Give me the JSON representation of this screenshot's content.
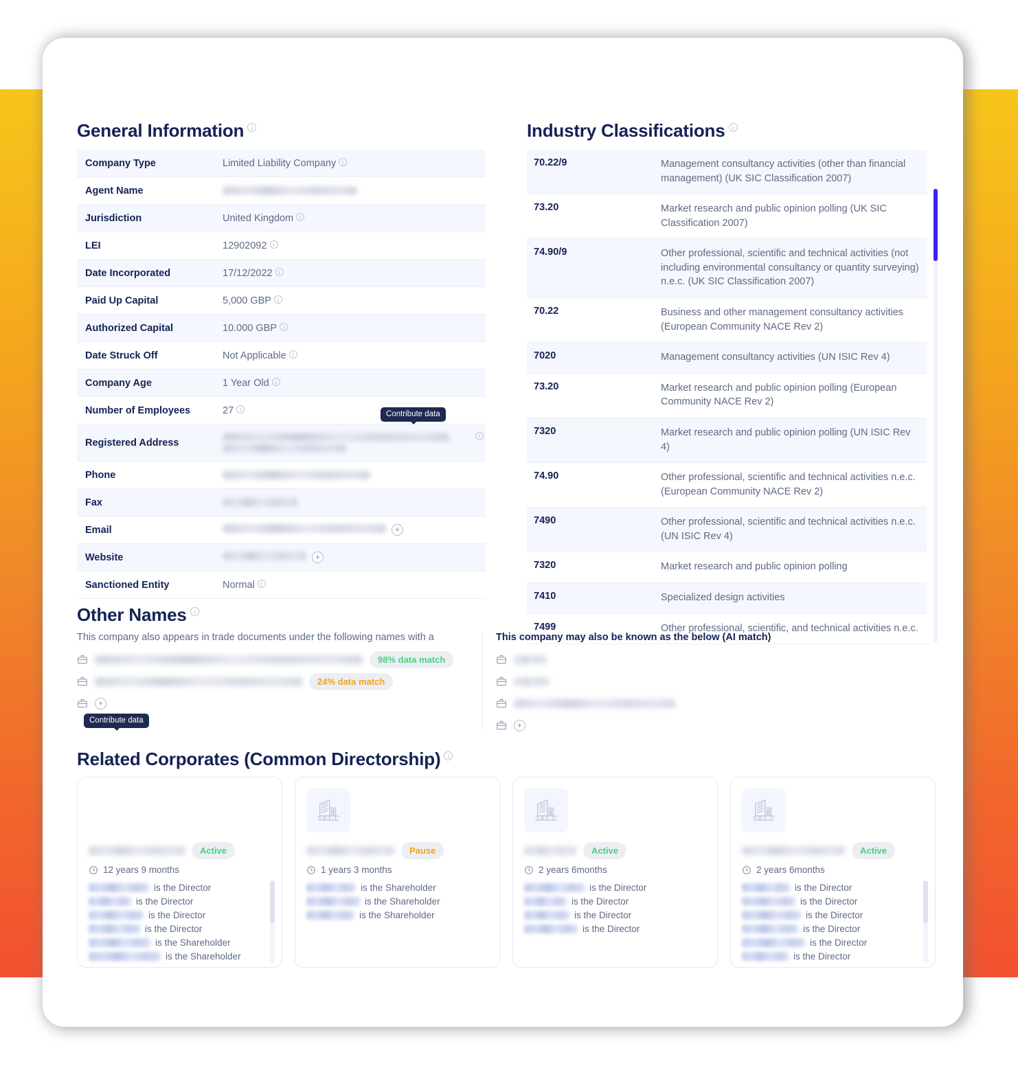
{
  "general_information": {
    "title": "General Information",
    "rows": [
      {
        "label": "Company Type",
        "value": "Limited Liability Company",
        "redacted": false,
        "info": true
      },
      {
        "label": "Agent Name",
        "value": "",
        "redacted": true,
        "blur_width": 196,
        "info": true
      },
      {
        "label": "Jurisdiction",
        "value": "United Kingdom",
        "redacted": false,
        "info": true
      },
      {
        "label": "LEI",
        "value": "12902092",
        "redacted": false,
        "info": true
      },
      {
        "label": "Date Incorporated",
        "value": "17/12/2022",
        "redacted": false,
        "info": true
      },
      {
        "label": "Paid Up Capital",
        "value": "5,000 GBP",
        "redacted": false,
        "info": true
      },
      {
        "label": "Authorized Capital",
        "value": "10.000 GBP",
        "redacted": false,
        "info": true
      },
      {
        "label": "Date Struck Off",
        "value": "Not Applicable",
        "redacted": false,
        "info": true
      },
      {
        "label": "Company Age",
        "value": "1 Year Old",
        "redacted": false,
        "info": true
      },
      {
        "label": "Number of Employees",
        "value": "27",
        "redacted": false,
        "info": true
      },
      {
        "label": "Registered Address",
        "value": "",
        "redacted": true,
        "two_line": true,
        "blur_width": 330,
        "blur_width2": 180,
        "info": true
      },
      {
        "label": "Phone",
        "value": "",
        "redacted": true,
        "blur_width": 215,
        "info": false
      },
      {
        "label": "Fax",
        "value": "",
        "redacted": true,
        "blur_width": 110,
        "info": false
      },
      {
        "label": "Email",
        "value": "",
        "redacted": true,
        "blur_width": 238,
        "plus": true,
        "tooltip": "Contribute data",
        "info": false
      },
      {
        "label": "Website",
        "value": "",
        "redacted": true,
        "blur_width": 122,
        "plus": true,
        "info": false
      },
      {
        "label": "Sanctioned Entity",
        "value": "Normal",
        "redacted": false,
        "info": true
      }
    ]
  },
  "industry_classifications": {
    "title": "Industry Classifications",
    "rows": [
      {
        "code": "70.22/9",
        "description": "Management consultancy activities (other than financial management) (UK SIC Classification 2007)"
      },
      {
        "code": "73.20",
        "description": "Market research and public opinion polling (UK SIC Classification 2007)"
      },
      {
        "code": "74.90/9",
        "description": "Other professional, scientific and technical activities (not including environmental consultancy or quantity surveying) n.e.c. (UK SIC Classification 2007)"
      },
      {
        "code": "70.22",
        "description": "Business and other management consultancy activities (European Community NACE Rev 2)"
      },
      {
        "code": "7020",
        "description": "Management consultancy activities (UN ISIC Rev 4)"
      },
      {
        "code": "73.20",
        "description": "Market research and public opinion polling (European Community NACE Rev 2)"
      },
      {
        "code": "7320",
        "description": "Market research and public opinion polling (UN ISIC Rev 4)"
      },
      {
        "code": "74.90",
        "description": "Other professional, scientific and technical activities n.e.c. (European Community NACE Rev 2)"
      },
      {
        "code": "7490",
        "description": "Other professional, scientific and technical activities n.e.c. (UN ISIC Rev 4)"
      },
      {
        "code": "7320",
        "description": "Market research and public opinion polling"
      },
      {
        "code": "7410",
        "description": "Specialized design activities"
      },
      {
        "code": "7499",
        "description": "Other professional, scientific, and technical activities n.e.c."
      }
    ]
  },
  "other_names": {
    "title": "Other Names",
    "left_subtitle": "This company also appears in trade documents under the following names with a",
    "right_subtitle": "This company may also be known as the below (AI match)",
    "left_items": [
      {
        "redacted": true,
        "blur_width": 390,
        "badge": "98% data match",
        "badge_color": "green"
      },
      {
        "redacted": true,
        "blur_width": 302,
        "badge": "24% data match",
        "badge_color": "orange"
      },
      {
        "redacted": false,
        "plus": true,
        "tooltip": "Contribute data"
      }
    ],
    "right_items": [
      {
        "redacted": true,
        "blur_width": 48
      },
      {
        "redacted": true,
        "blur_width": 52
      },
      {
        "redacted": true,
        "blur_width": 235
      },
      {
        "redacted": false,
        "plus": true
      }
    ]
  },
  "related_corporates": {
    "title": "Related Corporates (Common Directorship)",
    "cards": [
      {
        "has_logo": false,
        "name_blur_width": 140,
        "status": "Active",
        "status_color": "green",
        "age": "12 years 9 months",
        "people": [
          {
            "name_blur_width": 88,
            "role": "is the Director"
          },
          {
            "name_blur_width": 62,
            "role": "is the Director"
          },
          {
            "name_blur_width": 80,
            "role": "is the Director"
          },
          {
            "name_blur_width": 75,
            "role": "is the Director"
          },
          {
            "name_blur_width": 90,
            "role": "is the Shareholder"
          },
          {
            "name_blur_width": 105,
            "role": "is the Shareholder"
          }
        ],
        "scroll": true,
        "thumb_top": 0
      },
      {
        "has_logo": true,
        "name_blur_width": 128,
        "status": "Pause",
        "status_color": "orange",
        "age": "1 years 3 months",
        "people": [
          {
            "name_blur_width": 72,
            "role": "is the Shareholder"
          },
          {
            "name_blur_width": 78,
            "role": "is the Shareholder"
          },
          {
            "name_blur_width": 70,
            "role": "is the Shareholder"
          }
        ],
        "scroll": false,
        "thumb_top": 0
      },
      {
        "has_logo": true,
        "name_blur_width": 76,
        "status": "Active",
        "status_color": "green",
        "age": "2 years 6months",
        "people": [
          {
            "name_blur_width": 88,
            "role": "is the Director"
          },
          {
            "name_blur_width": 62,
            "role": "is the Director"
          },
          {
            "name_blur_width": 66,
            "role": "is the Director"
          },
          {
            "name_blur_width": 78,
            "role": "is the Director"
          }
        ],
        "scroll": false,
        "thumb_top": 0
      },
      {
        "has_logo": true,
        "name_blur_width": 150,
        "status": "Active",
        "status_color": "green",
        "age": "2 years 6months",
        "people": [
          {
            "name_blur_width": 70,
            "role": "is the Director"
          },
          {
            "name_blur_width": 78,
            "role": "is the Director"
          },
          {
            "name_blur_width": 86,
            "role": "is the Director"
          },
          {
            "name_blur_width": 82,
            "role": "is the Director"
          },
          {
            "name_blur_width": 92,
            "role": "is the Director"
          },
          {
            "name_blur_width": 68,
            "role": "is the Director"
          }
        ],
        "scroll": true,
        "thumb_top": 0
      }
    ]
  },
  "colors": {
    "heading": "#152255",
    "label": "#152255",
    "value": "#5e6a85",
    "row_alt": "#f4f7fd",
    "scroll_thumb": "#3a22ef",
    "green": "#4ad17f",
    "orange": "#f5a31c",
    "tooltip_bg": "#1d2a52",
    "bg_gradient_from": "#F7C51B",
    "bg_gradient_to": "#F2512F"
  }
}
